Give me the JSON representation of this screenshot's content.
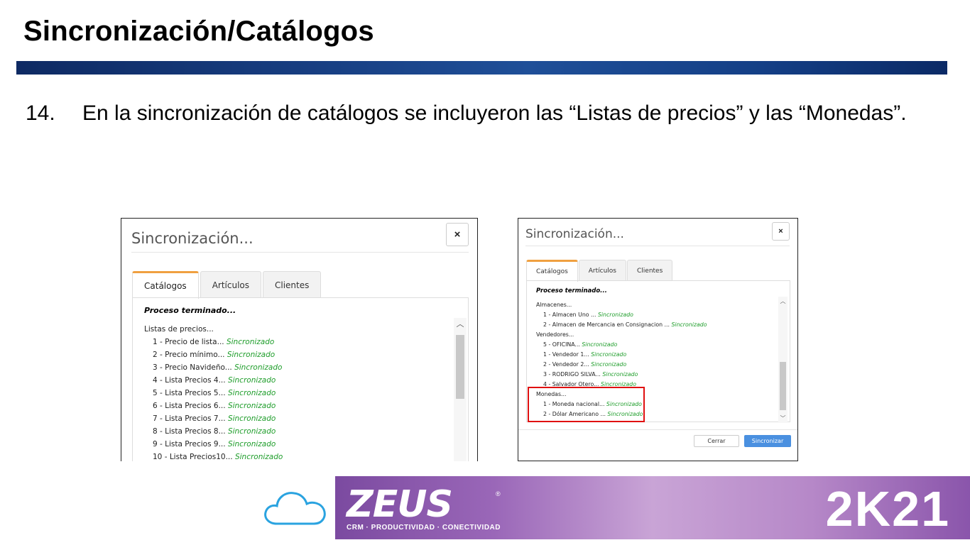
{
  "slide": {
    "title": "Sincronización/Catálogos",
    "bullet_number": "14.",
    "bullet_text": "En la sincronización de catálogos se incluyeron las “Listas de precios” y las “Monedas”."
  },
  "dialog_left": {
    "title": "Sincronización...",
    "close": "×",
    "tabs": [
      "Catálogos",
      "Artículos",
      "Clientes"
    ],
    "status": "Proceso terminado...",
    "group": "Listas de precios...",
    "items": [
      {
        "label": "1 - Precio de lista...",
        "status": "Sincronizado"
      },
      {
        "label": "2 - Precio mínimo...",
        "status": "Sincronizado"
      },
      {
        "label": "3 - Precio Navideño...",
        "status": "Sincronizado"
      },
      {
        "label": "4 - Lista Precios 4...",
        "status": "Sincronizado"
      },
      {
        "label": "5 - Lista Precios 5...",
        "status": "Sincronizado"
      },
      {
        "label": "6 - Lista Precios 6...",
        "status": "Sincronizado"
      },
      {
        "label": "7 - Lista Precios 7...",
        "status": "Sincronizado"
      },
      {
        "label": "8 - Lista Precios 8...",
        "status": "Sincronizado"
      },
      {
        "label": "9 - Lista Precios 9...",
        "status": "Sincronizado"
      },
      {
        "label": "10 - Lista Precios10...",
        "status": "Sincronizado"
      }
    ]
  },
  "dialog_right": {
    "title": "Sincronización...",
    "close": "×",
    "tabs": [
      "Catálogos",
      "Artículos",
      "Clientes"
    ],
    "status": "Proceso terminado...",
    "groups": [
      {
        "name": "Almacenes...",
        "items": [
          {
            "label": "1 - Almacen Uno ...",
            "status": "Sincronizado"
          },
          {
            "label": "2 - Almacen de Mercancia en Consignacion ...",
            "status": "Sincronizado"
          }
        ]
      },
      {
        "name": "Vendedores...",
        "items": [
          {
            "label": "5 - OFICINA...",
            "status": "Sincronizado"
          },
          {
            "label": "1 - Vendedor 1...",
            "status": "Sincronizado"
          },
          {
            "label": "2 - Vendedor 2...",
            "status": "Sincronizado"
          },
          {
            "label": "3 - RODRIGO SILVA...",
            "status": "Sincronizado"
          },
          {
            "label": "4 - Salvador Otero...",
            "status": "Sincronizado"
          }
        ]
      },
      {
        "name": "Monedas...",
        "items": [
          {
            "label": "1 - Moneda nacional...",
            "status": "Sincronizado"
          },
          {
            "label": "2 - Dólar Americano ...",
            "status": "Sincronizado"
          }
        ]
      }
    ],
    "btn_close": "Cerrar",
    "btn_sync": "Sincronizar"
  },
  "footer": {
    "logo_text": "ZEUS",
    "registered": "®",
    "tagline": "CRM · PRODUCTIVIDAD · CONECTIVIDAD",
    "edition": "2K21",
    "icon": "cloud-icon",
    "colors": {
      "banner_start": "#7b4aa0",
      "banner_mid": "#c9a4d6",
      "cloud": "#2aa3e0",
      "title_bar": "#173d80",
      "status_ok": "#1e9d2a",
      "highlight": "#e01010"
    }
  }
}
